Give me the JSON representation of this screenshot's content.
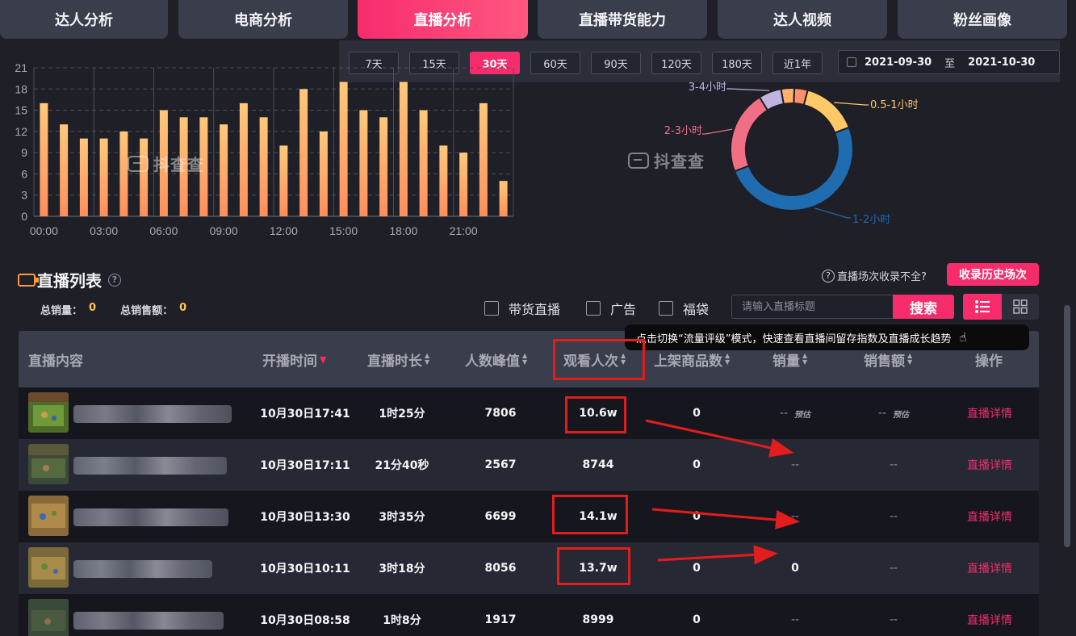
{
  "tabs": [
    {
      "label": "达人分析",
      "active": false
    },
    {
      "label": "电商分析",
      "active": false
    },
    {
      "label": "直播分析",
      "active": true
    },
    {
      "label": "直播带货能力",
      "active": false
    },
    {
      "label": "达人视频",
      "active": false
    },
    {
      "label": "粉丝画像",
      "active": false
    }
  ],
  "range_buttons": [
    {
      "label": "7天",
      "active": false
    },
    {
      "label": "15天",
      "active": false
    },
    {
      "label": "30天",
      "active": true
    },
    {
      "label": "60天",
      "active": false
    },
    {
      "label": "90天",
      "active": false
    },
    {
      "label": "120天",
      "active": false
    },
    {
      "label": "180天",
      "active": false
    },
    {
      "label": "近1年",
      "active": false
    }
  ],
  "date_range": {
    "start": "2021-09-30",
    "separator": "至",
    "end": "2021-10-30"
  },
  "watermark": "抖查查",
  "chart_data": [
    {
      "type": "bar",
      "title": "",
      "xlabel": "",
      "ylabel": "",
      "ylim": [
        0,
        21
      ],
      "yticks": [
        0,
        3,
        6,
        9,
        12,
        15,
        18,
        21
      ],
      "xtick_labels": [
        "00:00",
        "03:00",
        "06:00",
        "09:00",
        "12:00",
        "15:00",
        "18:00",
        "21:00"
      ],
      "categories": [
        "0",
        "1",
        "2",
        "3",
        "4",
        "5",
        "6",
        "7",
        "8",
        "9",
        "10",
        "11",
        "12",
        "13",
        "14",
        "15",
        "16",
        "17",
        "18",
        "19",
        "20",
        "21",
        "22",
        "23"
      ],
      "values": [
        16,
        13,
        11,
        11,
        12,
        11,
        15,
        14,
        14,
        13,
        16,
        14,
        10,
        18,
        12,
        19,
        15,
        14,
        19,
        15,
        10,
        9,
        16,
        5
      ],
      "bar_gradient": [
        "#ffc97a",
        "#ff8e5c"
      ],
      "grid": true
    },
    {
      "type": "pie",
      "style": "donut",
      "slices": [
        {
          "label": "0.5-1小时",
          "value": 15,
          "color": "#ffc967"
        },
        {
          "label": "1-2小时",
          "value": 50,
          "color": "#1f6cb0"
        },
        {
          "label": "2-3小时",
          "value": 22,
          "color": "#f16f84"
        },
        {
          "label": "3-4小时",
          "value": 6,
          "color": "#c1b2e3"
        },
        {
          "label": "",
          "value": 3.5,
          "color": "#ffb06d"
        },
        {
          "label": "",
          "value": 3.5,
          "color": "#ff8f6b"
        }
      ]
    }
  ],
  "list": {
    "title": "直播列表",
    "help": "?",
    "total_sales_label": "总销量：",
    "total_sales_value": "0",
    "total_amount_label": "总销售额：",
    "total_amount_value": "0",
    "incomplete_text": "直播场次收录不全?",
    "record_button": "收录历史场次",
    "filters": [
      "带货直播",
      "广告",
      "福袋"
    ],
    "search_placeholder": "请输入直播标题",
    "search_button": "搜索",
    "tooltip": "点击切换“流量评级”模式，快速查看直播间留存指数及直播成长趋势",
    "columns": [
      "直播内容",
      "开播时间",
      "直播时长",
      "人数峰值",
      "观看人次",
      "上架商品数",
      "销量",
      "销售额",
      "操作"
    ],
    "estimate_label": "预估",
    "rows": [
      {
        "time": "10月30日17:41",
        "duration": "1时25分",
        "peak": "7806",
        "views": "10.6w",
        "products": "0",
        "sales": "--",
        "amount": "--",
        "sales_est": true,
        "action": "直播详情"
      },
      {
        "time": "10月30日17:11",
        "duration": "21分40秒",
        "peak": "2567",
        "views": "8744",
        "products": "0",
        "sales": "--",
        "amount": "--",
        "sales_est": false,
        "action": "直播详情"
      },
      {
        "time": "10月30日13:30",
        "duration": "3时35分",
        "peak": "6699",
        "views": "14.1w",
        "products": "0",
        "sales": "--",
        "amount": "--",
        "sales_est": false,
        "action": "直播详情"
      },
      {
        "time": "10月30日10:11",
        "duration": "3时18分",
        "peak": "8056",
        "views": "13.7w",
        "products": "0",
        "sales": "0",
        "amount": "--",
        "sales_est": false,
        "action": "直播详情"
      },
      {
        "time": "10月30日08:58",
        "duration": "1时8分",
        "peak": "1917",
        "views": "8999",
        "products": "0",
        "sales": "--",
        "amount": "--",
        "sales_est": false,
        "action": "直播详情"
      }
    ]
  }
}
